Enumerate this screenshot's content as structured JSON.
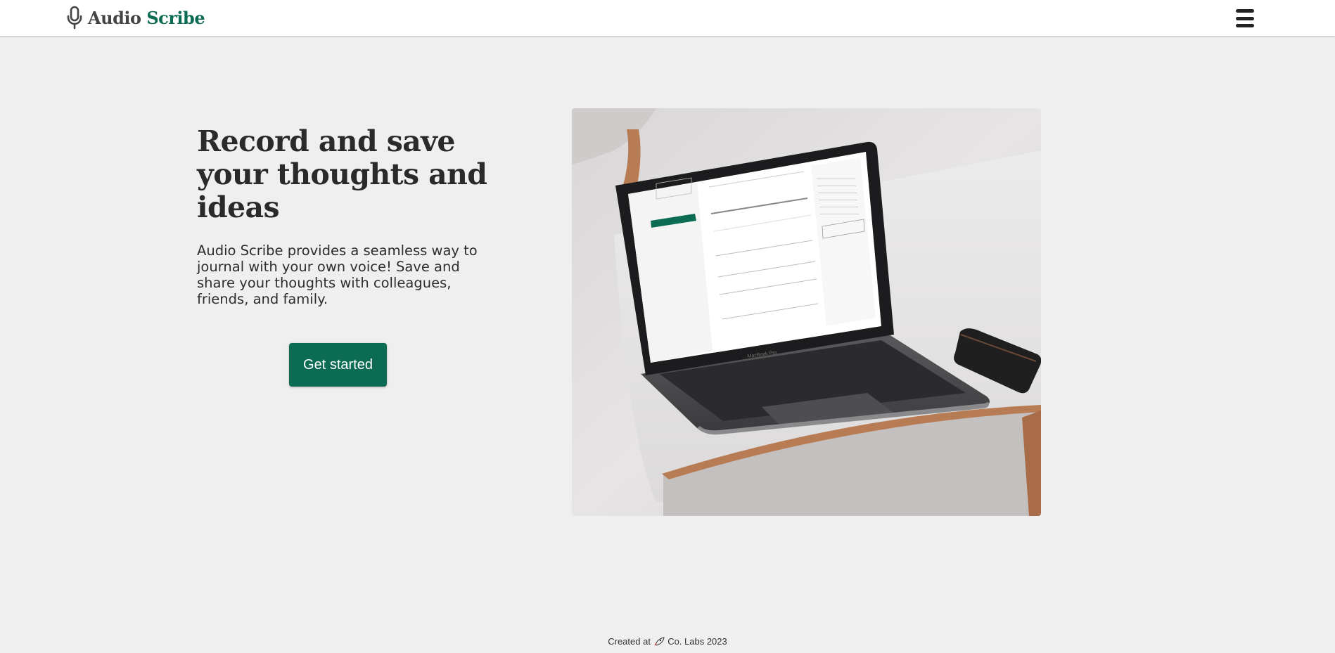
{
  "header": {
    "logo_word1": "Audio",
    "logo_word2": "Scribe",
    "logo_icon": "microphone-icon",
    "menu_icon": "hamburger-menu-icon"
  },
  "hero": {
    "title": "Record and save your thoughts and ideas",
    "description": "Audio Scribe provides a seamless way to journal with your own voice! Save and share your thoughts with colleagues, friends, and family.",
    "cta_label": "Get started"
  },
  "footer": {
    "prefix": "Created at",
    "icon": "rocket-icon",
    "suffix": "Co. Labs 2023"
  },
  "colors": {
    "brand": "#0b6b53",
    "background": "#efefef",
    "header_bg": "#ffffff"
  }
}
